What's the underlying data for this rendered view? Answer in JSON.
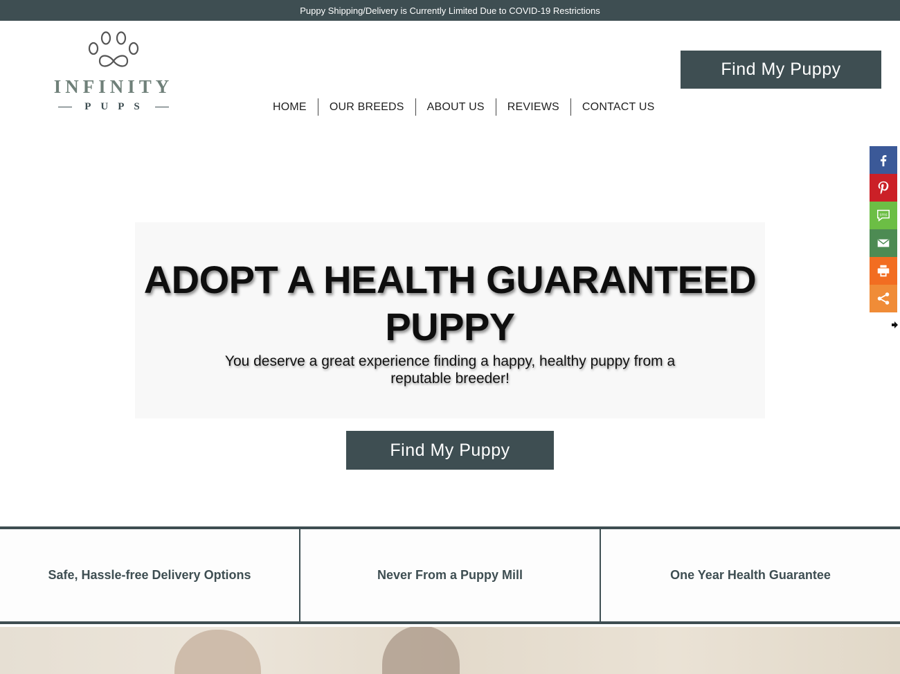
{
  "announcement": {
    "text": "Puppy Shipping/Delivery is Currently Limited Due to COVID-19 Restrictions"
  },
  "logo": {
    "word": "INFINITY",
    "sub": "PUPS",
    "icon": "paw-infinity-icon"
  },
  "nav": {
    "items": [
      {
        "label": "HOME"
      },
      {
        "label": "OUR BREEDS"
      },
      {
        "label": "ABOUT US"
      },
      {
        "label": "REVIEWS"
      },
      {
        "label": "CONTACT US"
      }
    ]
  },
  "header": {
    "cta_label": "Find My Puppy"
  },
  "hero": {
    "title": "ADOPT A HEALTH GUARANTEED PUPPY",
    "subtitle": "You deserve a great experience finding a happy, healthy puppy from a reputable breeder!",
    "cta_label": "Find My Puppy"
  },
  "share_bar": {
    "buttons": [
      {
        "name": "facebook",
        "icon": "facebook-icon",
        "color": "#3b5998"
      },
      {
        "name": "pinterest",
        "icon": "pinterest-icon",
        "color": "#cb2027"
      },
      {
        "name": "sms",
        "icon": "sms-icon",
        "color": "#6cbe45",
        "label": "sms"
      },
      {
        "name": "email",
        "icon": "email-icon",
        "color": "#4d8b53"
      },
      {
        "name": "print",
        "icon": "print-icon",
        "color": "#f26d21"
      },
      {
        "name": "share",
        "icon": "share-icon",
        "color": "#f08c37"
      }
    ],
    "hide_icon": "hide-arrow-icon"
  },
  "features": [
    {
      "label": "Safe, Hassle-free Delivery Options"
    },
    {
      "label": "Never From a Puppy Mill"
    },
    {
      "label": "One Year Health Guarantee"
    }
  ],
  "colors": {
    "brand": "#3e4e52",
    "logo_text": "#6f8079",
    "hero_box": "#f8f8f8"
  }
}
